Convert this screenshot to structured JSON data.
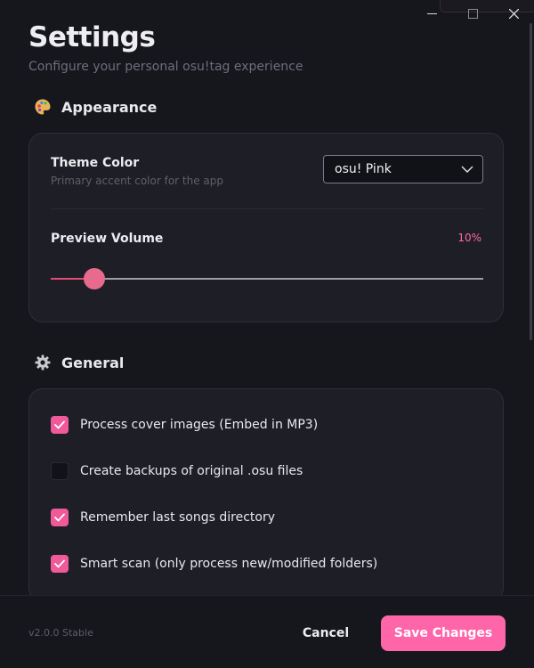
{
  "window": {
    "controls": [
      "minimize-icon",
      "maximize-icon",
      "close-icon"
    ]
  },
  "header": {
    "title": "Settings",
    "subtitle": "Configure your personal osu!tag experience"
  },
  "appearance": {
    "section_title": "Appearance",
    "section_icon": "palette-icon",
    "theme": {
      "title": "Theme Color",
      "description": "Primary accent color for the app",
      "selected": "osu! Pink"
    },
    "volume": {
      "title": "Preview Volume",
      "value_label": "10%",
      "value": 0.1
    }
  },
  "general": {
    "section_title": "General",
    "section_icon": "gear-icon",
    "options": [
      {
        "label": "Process cover images (Embed in MP3)",
        "checked": true
      },
      {
        "label": "Create backups of original .osu files",
        "checked": false
      },
      {
        "label": "Remember last songs directory",
        "checked": true
      },
      {
        "label": "Smart scan (only process new/modified folders)",
        "checked": true
      }
    ]
  },
  "footer": {
    "version": "v2.0.0 Stable",
    "cancel_label": "Cancel",
    "save_label": "Save Changes"
  },
  "colors": {
    "accent": "#ff66aa",
    "background": "#16171d",
    "card": "#1e1f26"
  }
}
